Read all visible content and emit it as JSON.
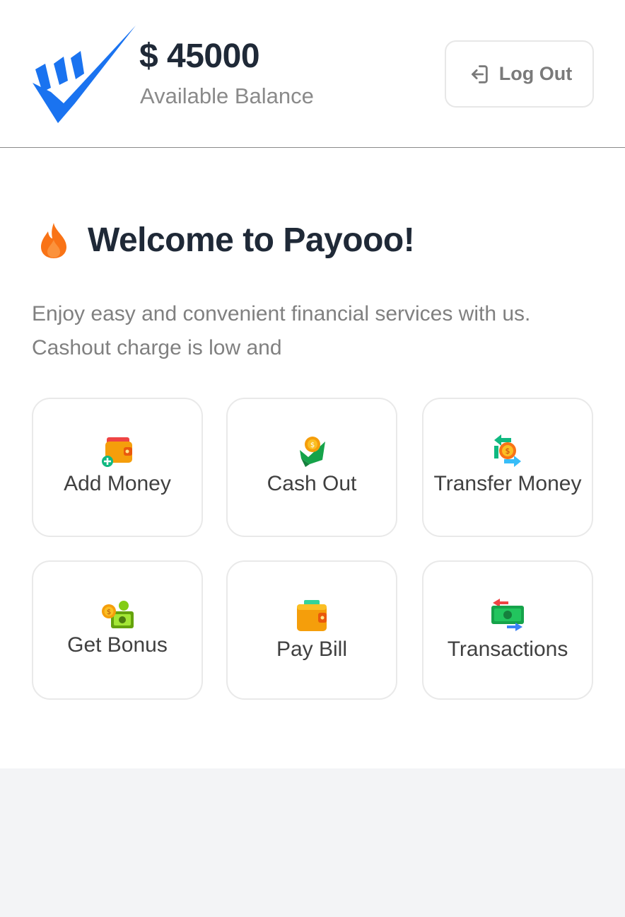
{
  "header": {
    "balance": "$ 45000",
    "balance_label": "Available Balance",
    "logout_label": "Log Out"
  },
  "welcome": {
    "title": "Welcome to Payooo!",
    "description_line1": "Enjoy easy and convenient financial services with us.",
    "description_line2": "Cashout charge is low and"
  },
  "actions": [
    {
      "label": "Add Money",
      "icon": "wallet-add-icon"
    },
    {
      "label": "Cash Out",
      "icon": "cash-out-icon"
    },
    {
      "label": "Transfer Money",
      "icon": "transfer-icon"
    },
    {
      "label": "Get Bonus",
      "icon": "bonus-icon"
    },
    {
      "label": "Pay Bill",
      "icon": "wallet-icon"
    },
    {
      "label": "Transactions",
      "icon": "transactions-icon"
    }
  ],
  "colors": {
    "brand_blue": "#1a73f0",
    "text_dark": "#1f2937",
    "text_muted": "#808080",
    "card_border": "#e9e9e9",
    "footer_bg": "#f3f4f6"
  }
}
